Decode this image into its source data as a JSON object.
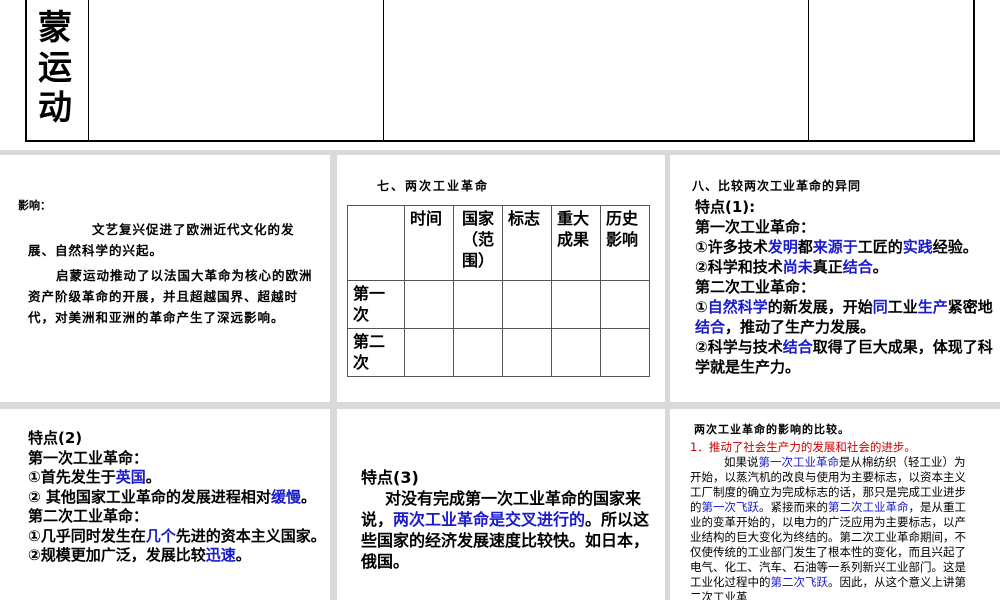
{
  "top": {
    "chars": [
      "蒙",
      "运",
      "动"
    ]
  },
  "panelA": {
    "heading": "影响：",
    "para1": "文艺复兴促进了欧洲近代文化的发展、自然科学的兴起。",
    "para2": "启蒙运动推动了以法国大革命为核心的欧洲资产阶级革命的开展，并且超越国界、超越时代，对美洲和亚洲的革命产生了深远影响。"
  },
  "panelB": {
    "title": "七、两次工业革命",
    "headers": [
      "",
      "时间",
      "国家（范围）",
      "标志",
      "重大成果",
      "历史影响"
    ],
    "rows": [
      "第一次",
      "第二次"
    ]
  },
  "panelC": {
    "title": "八、比较两次工业革命的异同",
    "subtitle": "特点(1):",
    "first_label": "第一次工业革命：",
    "f1_a": "①许多技术",
    "f1_b": "发明",
    "f1_c": "都",
    "f1_d": "来源于",
    "f1_e": "工匠的",
    "f1_f": "实践",
    "f1_g": "经验。",
    "f2_a": "②科学和技术",
    "f2_b": "尚未",
    "f2_c": "真正",
    "f2_d": "结合",
    "f2_e": "。",
    "second_label": "第二次工业革命：",
    "s1_a": "①",
    "s1_b": "自然科学",
    "s1_c": "的新发展，开始",
    "s1_d": "同",
    "s1_e": "工业",
    "s1_f": "生产",
    "s1_g": "紧密地",
    "s1_h": "结合",
    "s1_i": "，推动了生产力发展。",
    "s2_a": "②科学与技术",
    "s2_b": "结合",
    "s2_c": "取得了巨大成果，体现了科学就是生产力。"
  },
  "panelD": {
    "subtitle": "特点(2)",
    "first_label": "第一次工业革命：",
    "f1_a": "①首先发生于",
    "f1_b": "英国",
    "f1_c": "。",
    "f2_a": "② 其他国家工业革命的发展进程相对",
    "f2_b": "缓慢",
    "f2_c": "。",
    "second_label": "第二次工业革命：",
    "s1_a": "①几乎同时发生在",
    "s1_b": "几个",
    "s1_c": "先进的资本主义国家。",
    "s2_a": "②规模更加广泛，发展比较",
    "s2_b": "迅速",
    "s2_c": "。"
  },
  "panelE": {
    "subtitle": "特点(3)",
    "text_a": "对没有完成第一次工业革命的国家来说，",
    "text_b": "两次工业革命是交叉进行的",
    "text_c": "。所以这些国家的经济发展速度比较快。如日本，俄国。"
  },
  "panelF": {
    "title": "两次工业革命的影响的比较。",
    "point1": "1．推动了社会生产力的发展和社会的进步。",
    "b_a": "如果说",
    "b_b": "第一次工业革命",
    "b_c": "是从棉纺织（轻工业）为开始，以蒸汽机的改良与使用为主要标志，以资本主义工厂制度的确立为完成标志的话，那只是完成工业进步的",
    "b_d": "第一次飞跃",
    "b_e": "。紧接而来的",
    "b_f": "第二次工业革命",
    "b_g": "，是从重工业的变革开始的，以电力的广泛应用为主要标志，以产业结构的巨大变化为终结的。第二次工业革命期间，不仅使传统的工业部门发生了根本性的变化，而且兴起了电气、化工、汽车、石油等一系列新兴工业部门。这是工业化过程中的",
    "b_h": "第二次飞跃",
    "b_i": "。因此，从这个意义上讲第二次工业革"
  },
  "colors": {
    "accent_blue": "#1a1acc",
    "accent_red": "#cc0000",
    "background": "#d9d9d9"
  }
}
